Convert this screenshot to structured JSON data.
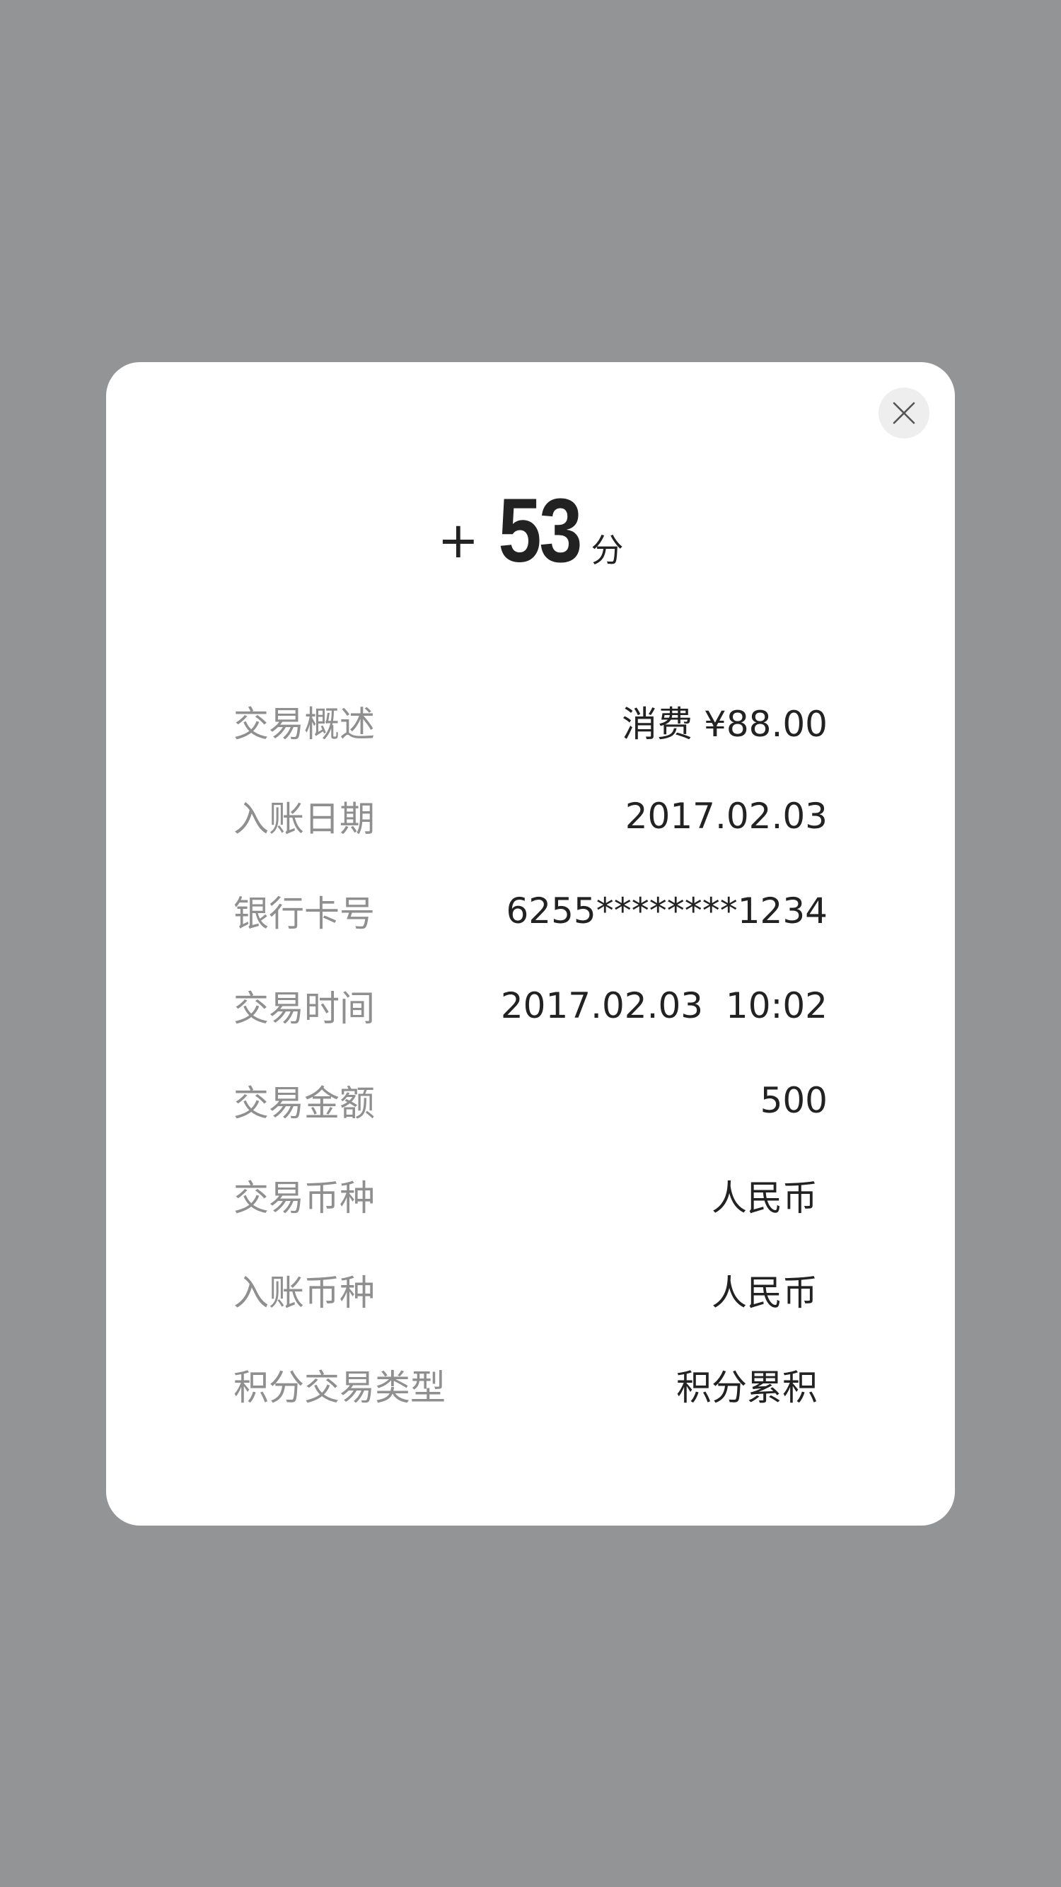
{
  "dialog": {
    "points": {
      "sign": "+",
      "value": "53",
      "unit": "分"
    },
    "close_icon": "close-icon",
    "details": [
      {
        "label": "交易概述",
        "value": "消费 ¥88.00"
      },
      {
        "label": "入账日期",
        "value": "2017.02.03"
      },
      {
        "label": "银行卡号",
        "value": "6255********1234"
      },
      {
        "label": "交易时间",
        "value": "2017.02.03  10:02"
      },
      {
        "label": "交易金额",
        "value": "500"
      },
      {
        "label": "交易币种",
        "value": "人民币"
      },
      {
        "label": "入账币种",
        "value": "人民币"
      },
      {
        "label": "积分交易类型",
        "value": "积分累积"
      }
    ]
  },
  "colors": {
    "backdrop": "#939496",
    "card": "#ffffff",
    "label": "#8f8f8f",
    "value": "#222222",
    "close_bg": "#eeeeee"
  }
}
